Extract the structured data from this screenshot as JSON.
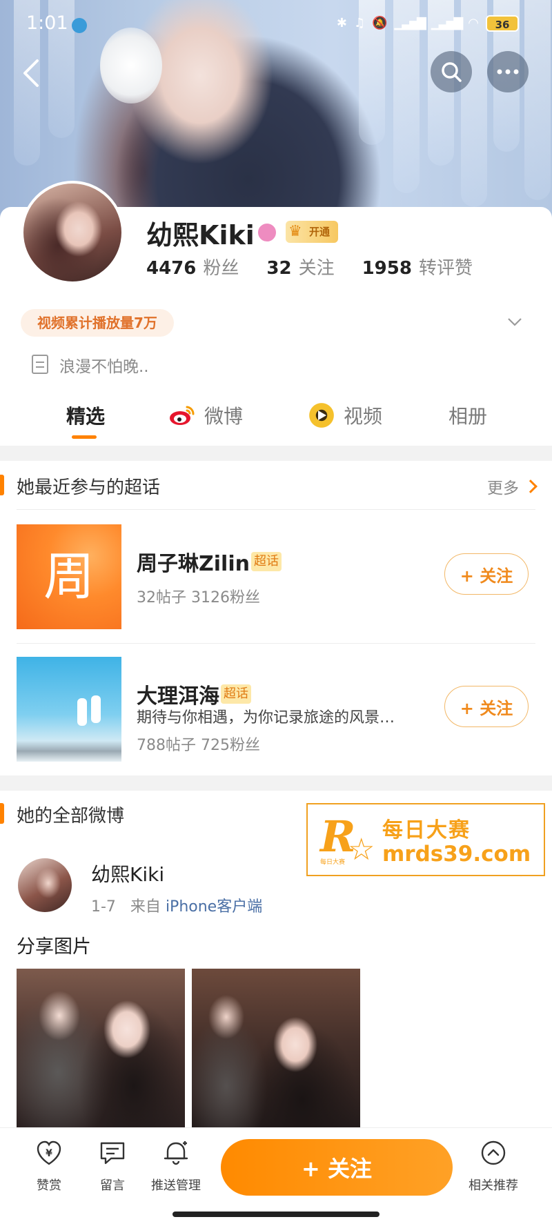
{
  "status_bar": {
    "time": "1:01",
    "battery": "36"
  },
  "profile": {
    "name": "幼熙Kiki",
    "vip_badge": "开通",
    "stats": [
      {
        "num": "4476",
        "label": "粉丝"
      },
      {
        "num": "32",
        "label": "关注"
      },
      {
        "num": "1958",
        "label": "转评赞"
      }
    ],
    "play_count_tag": "视频累计播放量7万",
    "bio": "浪漫不怕晚.."
  },
  "tabs": [
    {
      "label": "精选",
      "active": true
    },
    {
      "label": "微博",
      "icon": "weibo-icon"
    },
    {
      "label": "视频",
      "icon": "video-icon"
    },
    {
      "label": "相册"
    }
  ],
  "super_topics": {
    "title": "她最近参与的超话",
    "more": "更多",
    "tag": "超话",
    "follow_label": "+ 关注",
    "items": [
      {
        "name": "周子琳Zilin",
        "thumb_char": "周",
        "meta": "32帖子 3126粉丝"
      },
      {
        "name": "大理洱海",
        "desc": "期待与你相遇，为你记录旅途的风景…",
        "meta": "788帖子 725粉丝"
      }
    ]
  },
  "all_weibo": {
    "title": "她的全部微博",
    "post": {
      "author": "幼熙Kiki",
      "date": "1-7",
      "from": "来自",
      "source": "iPhone客户端",
      "text": "分享图片"
    }
  },
  "watermark": {
    "cn": "每日大赛",
    "url": "mrds39.com",
    "small": "每日大赛",
    "logo": "R"
  },
  "bottom_bar": {
    "items": [
      {
        "label": "赞赏",
        "icon": "reward-icon"
      },
      {
        "label": "留言",
        "icon": "message-icon"
      },
      {
        "label": "推送管理",
        "icon": "push-icon"
      },
      {
        "label": "相关推荐",
        "icon": "recommend-icon"
      }
    ],
    "follow": "+ 关注"
  },
  "colors": {
    "accent": "#ff8200",
    "tag_bg": "#fdf0e6",
    "link": "#4a6fa5"
  }
}
